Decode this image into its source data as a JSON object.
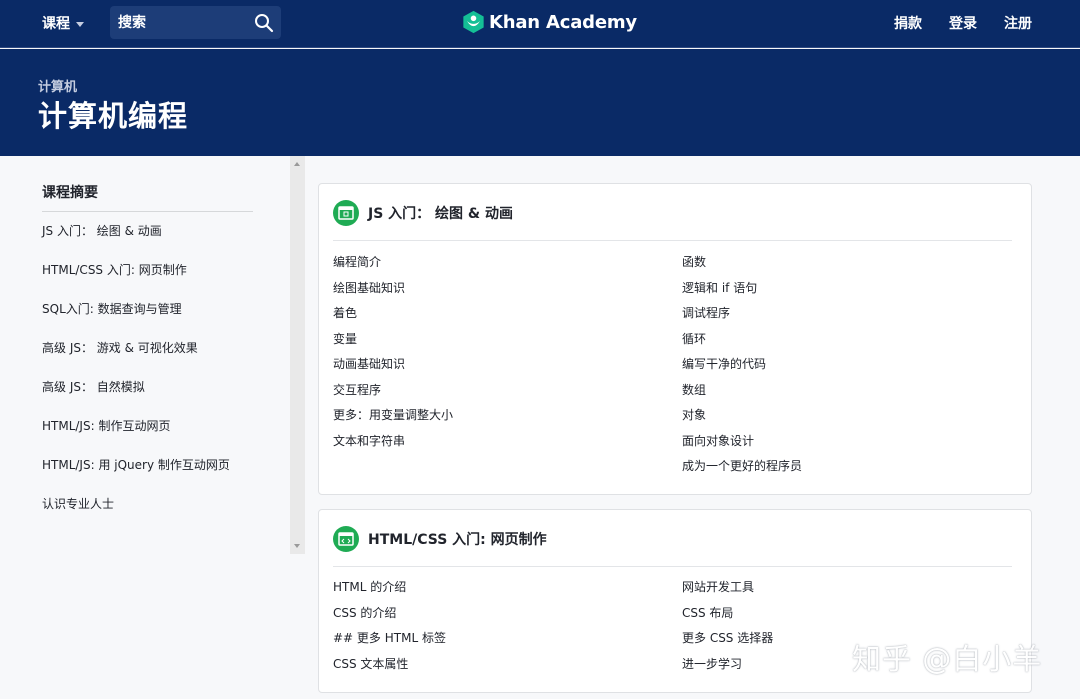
{
  "topnav": {
    "courses_label": "课程",
    "search_placeholder": "搜索",
    "brand_name": "Khan Academy",
    "links": [
      "捐款",
      "登录",
      "注册"
    ]
  },
  "header": {
    "breadcrumb": "计算机",
    "title": "计算机编程"
  },
  "sidebar": {
    "title": "课程摘要",
    "items": [
      "JS 入门：  绘图 & 动画",
      "HTML/CSS 入门: 网页制作",
      "SQL入门: 数据查询与管理",
      "高级 JS：  游戏 & 可视化效果",
      "高级 JS：  自然模拟",
      "HTML/JS: 制作互动网页",
      "HTML/JS: 用 jQuery 制作互动网页",
      "认识专业人士"
    ]
  },
  "cards": [
    {
      "title": "JS 入门：  绘图 & 动画",
      "left": [
        "编程简介",
        "绘图基础知识",
        "着色",
        "变量",
        "动画基础知识",
        "交互程序",
        "更多：用变量调整大小",
        "文本和字符串"
      ],
      "right": [
        "函数",
        "逻辑和 if 语句",
        "调试程序",
        "循环",
        "编写干净的代码",
        "数组",
        "对象",
        "面向对象设计",
        "成为一个更好的程序员"
      ]
    },
    {
      "title": "HTML/CSS 入门: 网页制作",
      "left": [
        "HTML 的介绍",
        "CSS 的介绍",
        "## 更多 HTML 标签",
        "CSS 文本属性"
      ],
      "right": [
        "网站开发工具",
        "CSS 布局",
        "更多 CSS 选择器",
        "进一步学习"
      ]
    }
  ],
  "watermark": "知乎 @白小羊",
  "colors": {
    "navy": "#0a2a66",
    "green": "#1fab54",
    "text": "#21242c"
  }
}
